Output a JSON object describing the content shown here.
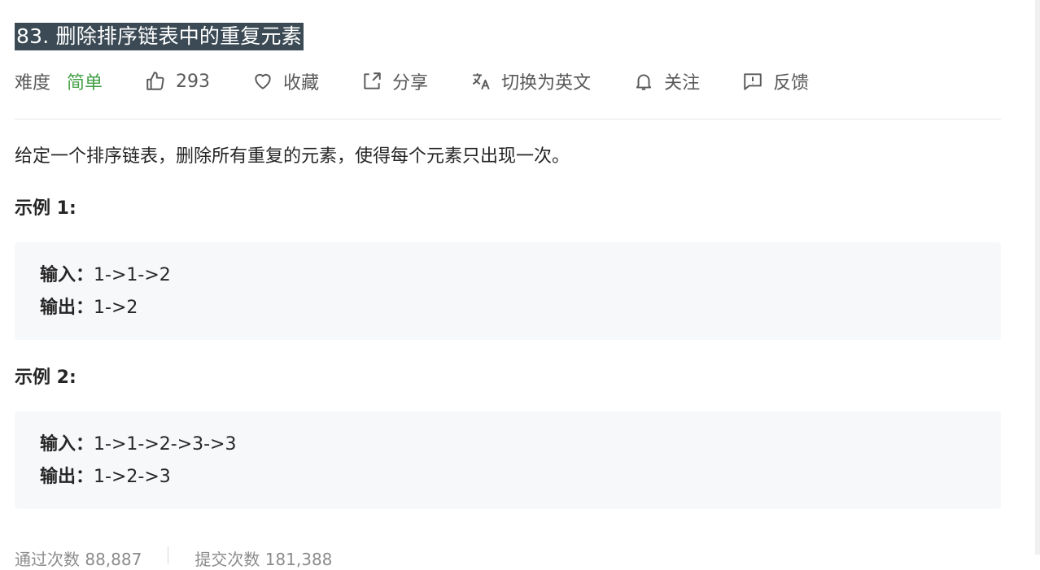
{
  "problem": {
    "title": "83. 删除排序链表中的重复元素"
  },
  "meta": {
    "difficulty_label": "难度",
    "difficulty_value": "简单",
    "likes": "293",
    "favorite": "收藏",
    "share": "分享",
    "translate": "切换为英文",
    "follow": "关注",
    "feedback": "反馈",
    "colors": {
      "difficulty": "#43a047",
      "title_bg": "#3b4a54"
    }
  },
  "description": "给定一个排序链表，删除所有重复的元素，使得每个元素只出现一次。",
  "examples": [
    {
      "title": "示例 1:",
      "input_label": "输入：",
      "input": "1->1->2",
      "output_label": "输出：",
      "output": "1->2"
    },
    {
      "title": "示例 2:",
      "input_label": "输入：",
      "input": "1->1->2->3->3",
      "output_label": "输出：",
      "output": "1->2->3"
    }
  ],
  "stats": {
    "accepted": "通过次数 88,887",
    "submissions": "提交次数 181,388"
  }
}
